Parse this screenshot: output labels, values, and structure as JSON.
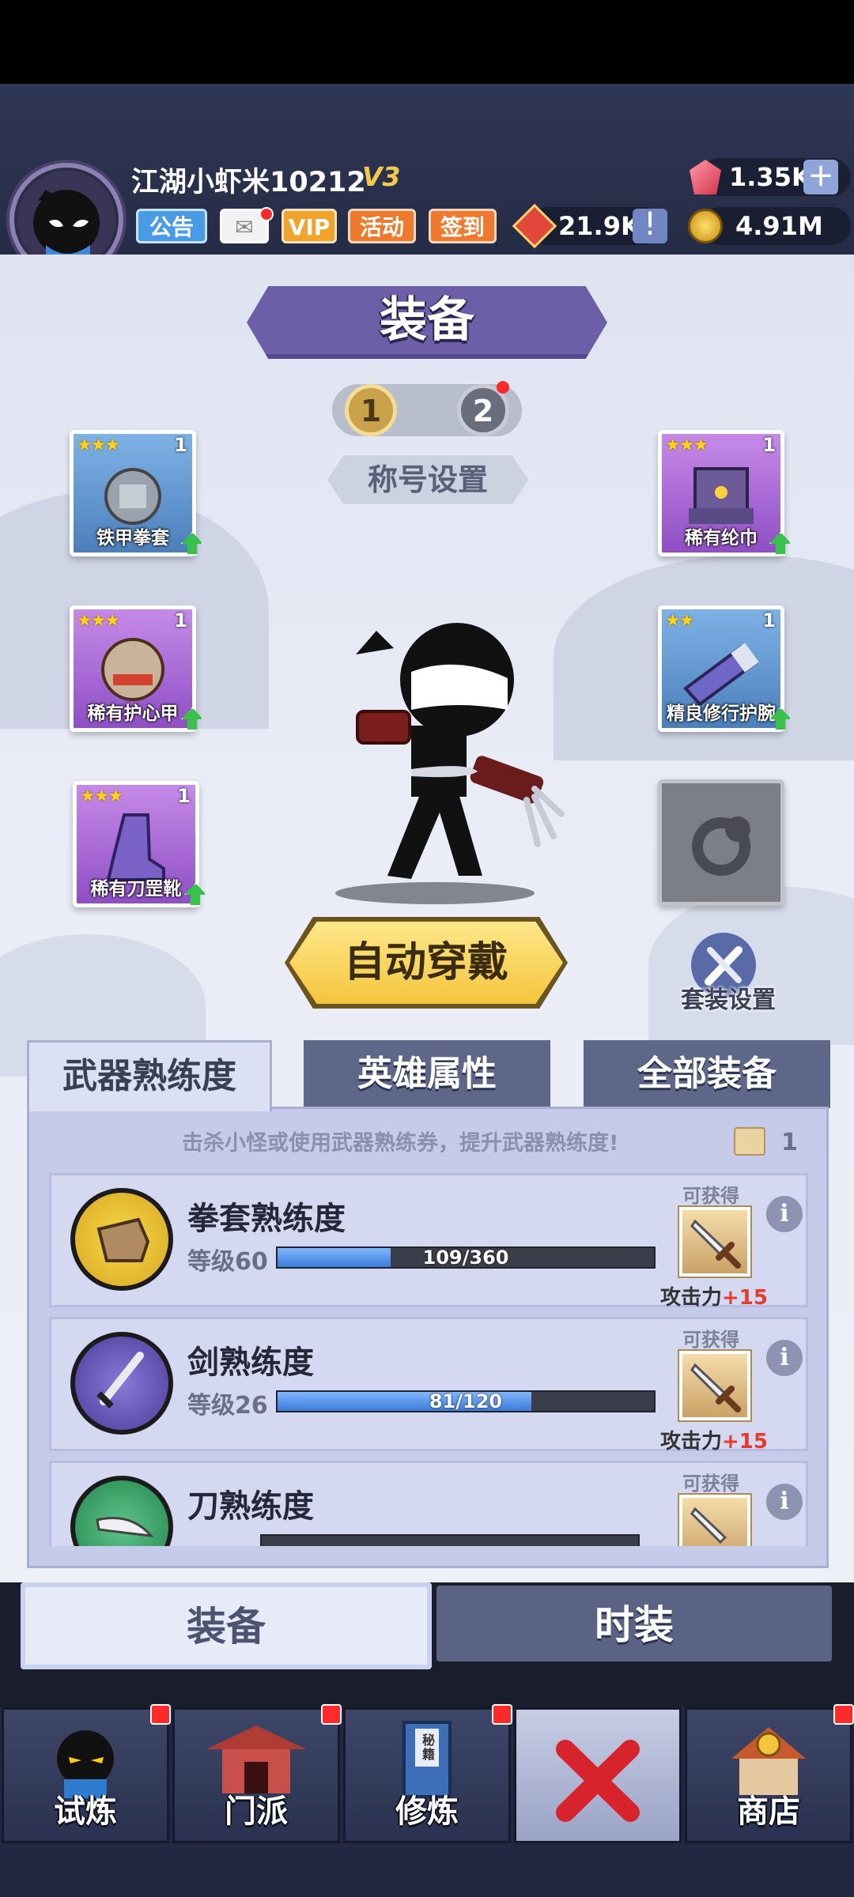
{
  "player": {
    "name": "江湖小虾米10212",
    "vip_level": "V3"
  },
  "top_buttons": {
    "notice": "公告",
    "vip": "VIP",
    "event": "活动",
    "signin": "签到"
  },
  "resources": {
    "gems": "1.35K",
    "honor": "21.9K",
    "coins": "4.91M"
  },
  "page_title": "装备",
  "pages": [
    "1",
    "2"
  ],
  "title_settings": "称号设置",
  "equipment_slots": {
    "gauntlet": {
      "name": "铁甲拳套",
      "stars": "★★★",
      "level": "1"
    },
    "helmet": {
      "name": "稀有纶巾",
      "stars": "★★★",
      "level": "1"
    },
    "armor": {
      "name": "稀有护心甲",
      "stars": "★★★",
      "level": "1"
    },
    "bracer": {
      "name": "精良修行护腕",
      "stars": "★★",
      "level": "1"
    },
    "boots": {
      "name": "稀有刀罡靴",
      "stars": "★★★",
      "level": "1"
    }
  },
  "auto_equip": "自动穿戴",
  "set_settings": "套装设置",
  "tabs": {
    "weapon_mastery": "武器熟练度",
    "hero_attributes": "英雄属性",
    "all_equipment": "全部装备"
  },
  "hint": "击杀小怪或使用武器熟练券，提升武器熟练度!",
  "ticket_count": "1",
  "mastery": [
    {
      "title": "拳套熟练度",
      "level": "等级60",
      "progress": "109/360",
      "fill": 0.3,
      "available": "可获得",
      "reward_label": "攻击力",
      "reward_value": "+15"
    },
    {
      "title": "剑熟练度",
      "level": "等级26",
      "progress": "81/120",
      "fill": 0.675,
      "available": "可获得",
      "reward_label": "攻击力",
      "reward_value": "+15"
    },
    {
      "title": "刀熟练度",
      "available": "可获得"
    }
  ],
  "bottom_tabs": {
    "equipment": "装备",
    "fashion": "时装"
  },
  "nav": {
    "trial": "试炼",
    "sect": "门派",
    "cultivate": "修炼",
    "shop": "商店",
    "book_tag": "秘籍"
  },
  "colors": {
    "accent_purple": "#6c5fa8",
    "gold": "#f3c43c",
    "progress_blue": "#3c7bd8",
    "reward_red": "#e53a2c"
  }
}
